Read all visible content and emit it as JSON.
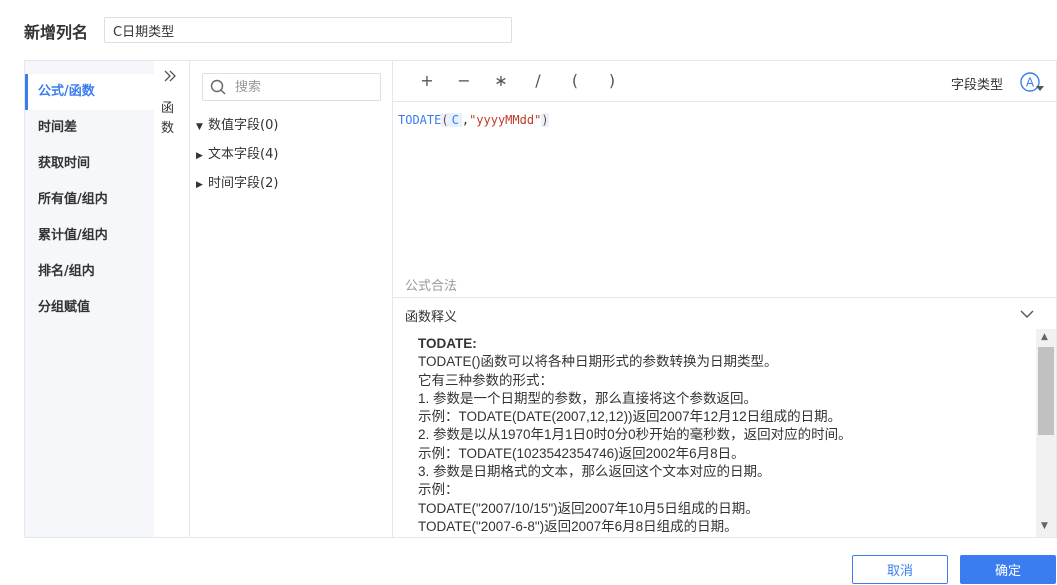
{
  "header": {
    "title": "新增列名",
    "column_name_value": "C日期类型"
  },
  "categories": [
    {
      "label": "公式/函数",
      "active": true
    },
    {
      "label": "时间差",
      "active": false
    },
    {
      "label": "获取时间",
      "active": false
    },
    {
      "label": "所有值/组内",
      "active": false
    },
    {
      "label": "累计值/组内",
      "active": false
    },
    {
      "label": "排名/组内",
      "active": false
    },
    {
      "label": "分组赋值",
      "active": false
    }
  ],
  "collapse": {
    "icon": "double-chevron-right-icon",
    "label_line1": "函",
    "label_line2": "数"
  },
  "fields_panel": {
    "search_placeholder": "搜索",
    "groups": [
      {
        "label": "数值字段(0)",
        "expanded": true
      },
      {
        "label": "文本字段(4)",
        "expanded": false
      },
      {
        "label": "时间字段(2)",
        "expanded": false
      }
    ]
  },
  "toolbar": {
    "operators": [
      "+",
      "−",
      "∗",
      "/",
      "(",
      ")"
    ],
    "field_type_label": "字段类型",
    "field_type_icon": "letter-a-circle-icon"
  },
  "formula": {
    "function": "TODATE",
    "open_paren": "(",
    "field": "C",
    "comma": ",",
    "string_arg": "\"yyyyMMdd\"",
    "close_paren": ")",
    "status": "公式合法"
  },
  "description": {
    "header": "函数释义",
    "lines": [
      "TODATE:",
      "TODATE()函数可以将各种日期形式的参数转换为日期类型。",
      "它有三种参数的形式：",
      "1. 参数是一个日期型的参数，那么直接将这个参数返回。",
      "示例：TODATE(DATE(2007,12,12))返回2007年12月12日组成的日期。",
      "2. 参数是以从1970年1月1日0时0分0秒开始的毫秒数，返回对应的时间。",
      "示例：TODATE(1023542354746)返回2002年6月8日。",
      "3. 参数是日期格式的文本，那么返回这个文本对应的日期。",
      "示例：",
      "TODATE(\"2007/10/15\")返回2007年10月5日组成的日期。",
      "TODATE(\"2007-6-8\")返回2007年6月8日组成的日期。"
    ]
  },
  "buttons": {
    "cancel": "取消",
    "ok": "确定"
  },
  "colors": {
    "accent": "#3b7df0",
    "string_literal": "#c0392b"
  }
}
